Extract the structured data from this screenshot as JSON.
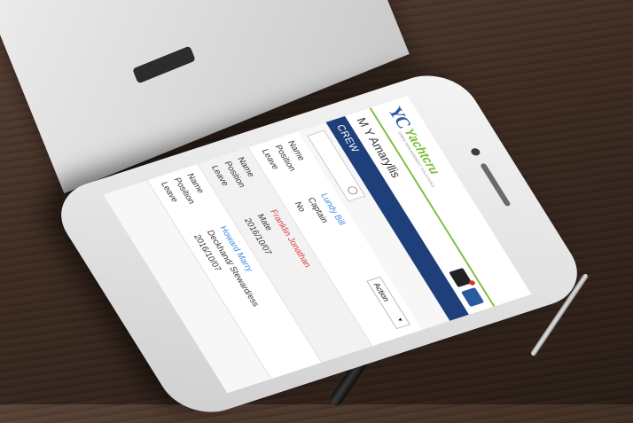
{
  "app": {
    "logo_mark": "YC",
    "logo_name": "Yachtcru",
    "logo_tagline": "CREW MANAGEMENT SOLUTIONS"
  },
  "vessel": {
    "name": "M Y Amaryllis"
  },
  "section": {
    "title": "CREW"
  },
  "search": {
    "placeholder": ""
  },
  "action": {
    "label": "Action"
  },
  "labels": {
    "name": "Name",
    "position": "Position",
    "leave": "Leave"
  },
  "crew": [
    {
      "name": "Lundy Bill",
      "position": "Captain",
      "leave": "No",
      "color": "#3c8be0"
    },
    {
      "name": "Franklin Jonathan",
      "position": "Mate",
      "leave": "2016/10/07",
      "color": "#e03c3c"
    },
    {
      "name": "Howard Marry",
      "position": "Deckhand/ Steward/ess",
      "leave": "2016/10/07",
      "color": "#3c8be0"
    }
  ],
  "colors": {
    "brand_blue": "#1f3f7a",
    "brand_green": "#7cbf3a"
  }
}
